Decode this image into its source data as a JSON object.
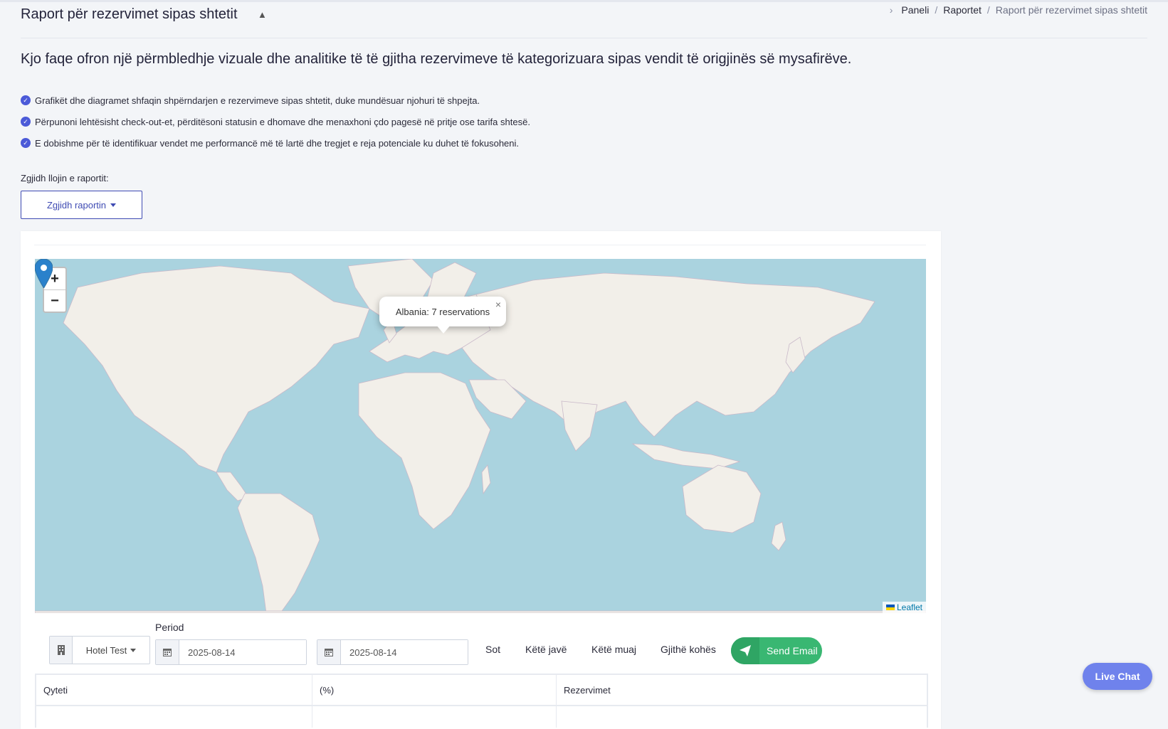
{
  "header": {
    "title": "Raport për rezervimet sipas shtetit",
    "collapse_icon": "▲",
    "breadcrumb": [
      "Paneli",
      "Raportet",
      "Raport për rezervimet sipas shtetit"
    ]
  },
  "intro": {
    "lead": "Kjo faqe ofron një përmbledhje vizuale dhe analitike të të gjitha rezervimeve të kategorizuara sipas vendit të origjinës së mysafirëve.",
    "bullets": [
      "Grafikët dhe diagramet shfaqin shpërndarjen e rezervimeve sipas shtetit, duke mundësuar njohuri të shpejta.",
      "Përpunoni lehtësisht check-out-et, përditësoni statusin e dhomave dhe menaxhoni çdo pagesë në pritje ose tarifa shtesë.",
      "E dobishme për të identifikuar vendet me performancë më të lartë dhe tregjet e reja potenciale ku duhet të fokusoheni."
    ]
  },
  "report_select": {
    "label": "Zgjidh llojin e raportit:",
    "button": "Zgjidh raportin"
  },
  "map": {
    "zoom_in": "+",
    "zoom_out": "−",
    "popup_text": "Albania: 7 reservations",
    "popup_close": "×",
    "attribution": "Leaflet",
    "colors": {
      "water": "#aad3df",
      "land": "#f2efe9",
      "marker": "#2a81cb"
    }
  },
  "filters": {
    "period_label": "Period",
    "hotel": "Hotel Test",
    "date_from": "2025-08-14",
    "date_to": "2025-08-14",
    "quick": [
      "Sot",
      "Këtë javë",
      "Këtë muaj",
      "Gjithë kohës"
    ],
    "send_email": "Send Email"
  },
  "table": {
    "columns": [
      "Qyteti",
      "(%)",
      "Rezervimet"
    ]
  },
  "live_chat": "Live Chat"
}
